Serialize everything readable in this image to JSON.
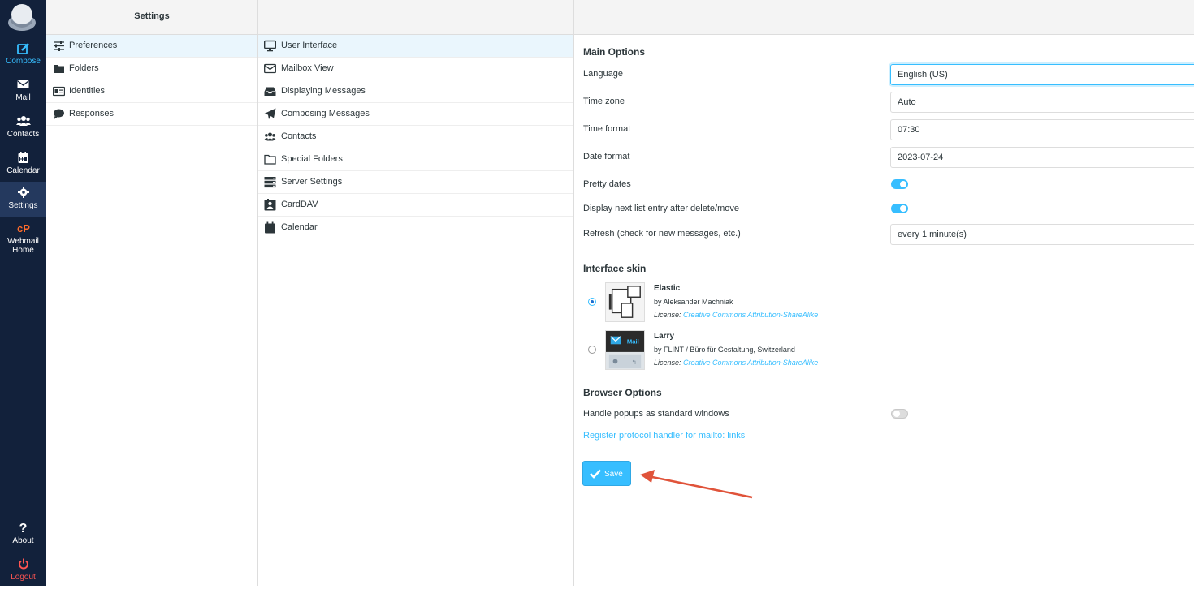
{
  "nav": {
    "compose": "Compose",
    "mail": "Mail",
    "contacts": "Contacts",
    "calendar": "Calendar",
    "settings": "Settings",
    "webmail_home_1": "Webmail",
    "webmail_home_2": "Home",
    "about": "About",
    "logout": "Logout"
  },
  "settings_col": {
    "title": "Settings",
    "items": [
      {
        "label": "Preferences",
        "icon": "sliders-icon"
      },
      {
        "label": "Folders",
        "icon": "folder-icon"
      },
      {
        "label": "Identities",
        "icon": "id-card-icon"
      },
      {
        "label": "Responses",
        "icon": "comment-icon"
      }
    ]
  },
  "sections_col": {
    "items": [
      {
        "label": "User Interface",
        "icon": "monitor-icon"
      },
      {
        "label": "Mailbox View",
        "icon": "envelope-icon"
      },
      {
        "label": "Displaying Messages",
        "icon": "inbox-icon"
      },
      {
        "label": "Composing Messages",
        "icon": "paper-plane-icon"
      },
      {
        "label": "Contacts",
        "icon": "users-icon"
      },
      {
        "label": "Special Folders",
        "icon": "folder-outline-icon"
      },
      {
        "label": "Server Settings",
        "icon": "server-icon"
      },
      {
        "label": "CardDAV",
        "icon": "address-book-icon"
      },
      {
        "label": "Calendar",
        "icon": "calendar-icon"
      }
    ]
  },
  "main": {
    "main_options_title": "Main Options",
    "language_label": "Language",
    "language_value": "English (US)",
    "timezone_label": "Time zone",
    "timezone_value": "Auto",
    "timeformat_label": "Time format",
    "timeformat_value": "07:30",
    "dateformat_label": "Date format",
    "dateformat_value": "2023-07-24",
    "pretty_dates_label": "Pretty dates",
    "pretty_dates_on": true,
    "next_entry_label": "Display next list entry after delete/move",
    "next_entry_on": true,
    "refresh_label": "Refresh (check for new messages, etc.)",
    "refresh_value": "every 1 minute(s)",
    "skin_title": "Interface skin",
    "skins": [
      {
        "name": "Elastic",
        "by": "by Aleksander Machniak",
        "license_prefix": "License:",
        "license": "Creative Commons Attribution-ShareAlike",
        "selected": true
      },
      {
        "name": "Larry",
        "by": "by FLINT / Büro für Gestaltung, Switzerland",
        "license_prefix": "License:",
        "license": "Creative Commons Attribution-ShareAlike",
        "selected": false,
        "thumb_text": "Mail"
      }
    ],
    "browser_title": "Browser Options",
    "popups_label": "Handle popups as standard windows",
    "popups_on": false,
    "protocol_link": "Register protocol handler for mailto: links",
    "save_label": "Save"
  },
  "colors": {
    "accent": "#37beff",
    "nav_bg": "#12213b",
    "annotation_arrow": "#e0533a"
  }
}
